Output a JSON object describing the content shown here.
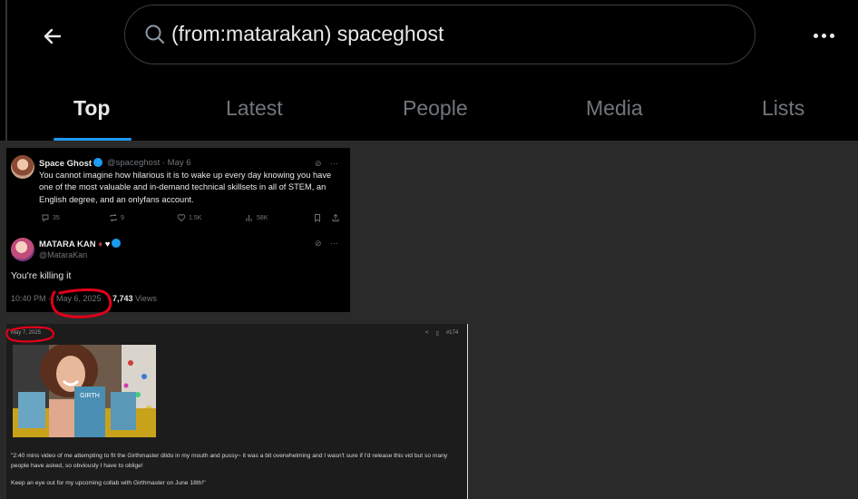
{
  "search": {
    "query": "(from:matarakan) spaceghost"
  },
  "tabs": [
    {
      "label": "Top",
      "active": true
    },
    {
      "label": "Latest",
      "active": false
    },
    {
      "label": "People",
      "active": false
    },
    {
      "label": "Media",
      "active": false
    },
    {
      "label": "Lists",
      "active": false
    }
  ],
  "quoted_tweet": {
    "name": "Space Ghost",
    "handle": "@spaceghost · May 6",
    "text": "You cannot imagine how hilarious it is to wake up every day knowing you have one of the most valuable and in-demand technical skillsets in all of STEM, an English degree, and an onlyfans account.",
    "replies": "35",
    "reposts": "9",
    "likes": "1.5K",
    "views": "58K"
  },
  "reply_tweet": {
    "name": "MATARA KAN",
    "handle": "@MataraKan",
    "text": "You're killing it",
    "time": "10:40 PM ·",
    "date": "May 6, 2025",
    "views_count": "7,743",
    "views_label": "Views"
  },
  "post2": {
    "date": "May 7, 2025",
    "post_number": "#174",
    "caption_line1": "\"2:40 mins video of me attempting to fit the Girthmaster dildo in my mouth and pussy~ it was a bit overwhelming and I wasn't sure if I'd release this vid but so many people have asked, so obviously I have to oblige!",
    "caption_line2": "Keep an eye out for my upcoming collab with Girthmaster on June 18th!\"",
    "photo_book_title": "GIRTH"
  },
  "colors": {
    "accent": "#1d9bf0",
    "annotation_red": "#e0001b",
    "muted": "#71767b"
  }
}
